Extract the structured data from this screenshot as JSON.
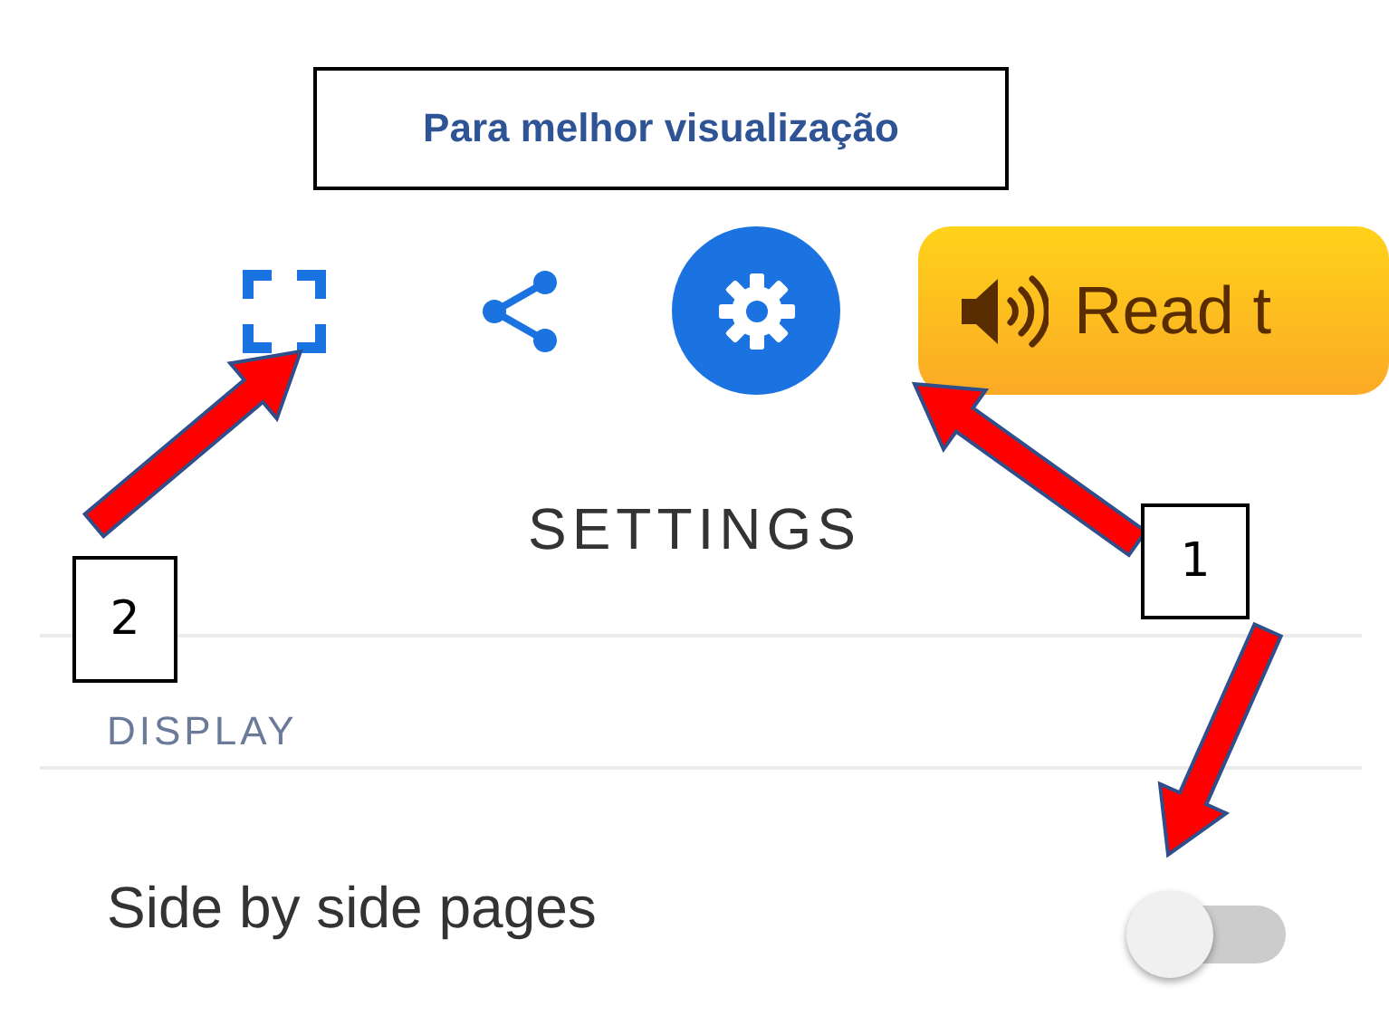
{
  "note": {
    "text": "Para melhor visualização"
  },
  "toolbar": {
    "tools": [
      {
        "kind": "fullscreen",
        "selected": false
      },
      {
        "kind": "share",
        "selected": false
      },
      {
        "kind": "settings",
        "selected": true
      }
    ],
    "read_button": {
      "label": "Read t"
    }
  },
  "settings": {
    "title": "SETTINGS",
    "sections": [
      {
        "heading": "DISPLAY",
        "options": [
          {
            "label": "Side by side pages",
            "on": false
          }
        ]
      }
    ]
  },
  "annotations": [
    {
      "number": "1"
    },
    {
      "number": "2"
    }
  ]
}
